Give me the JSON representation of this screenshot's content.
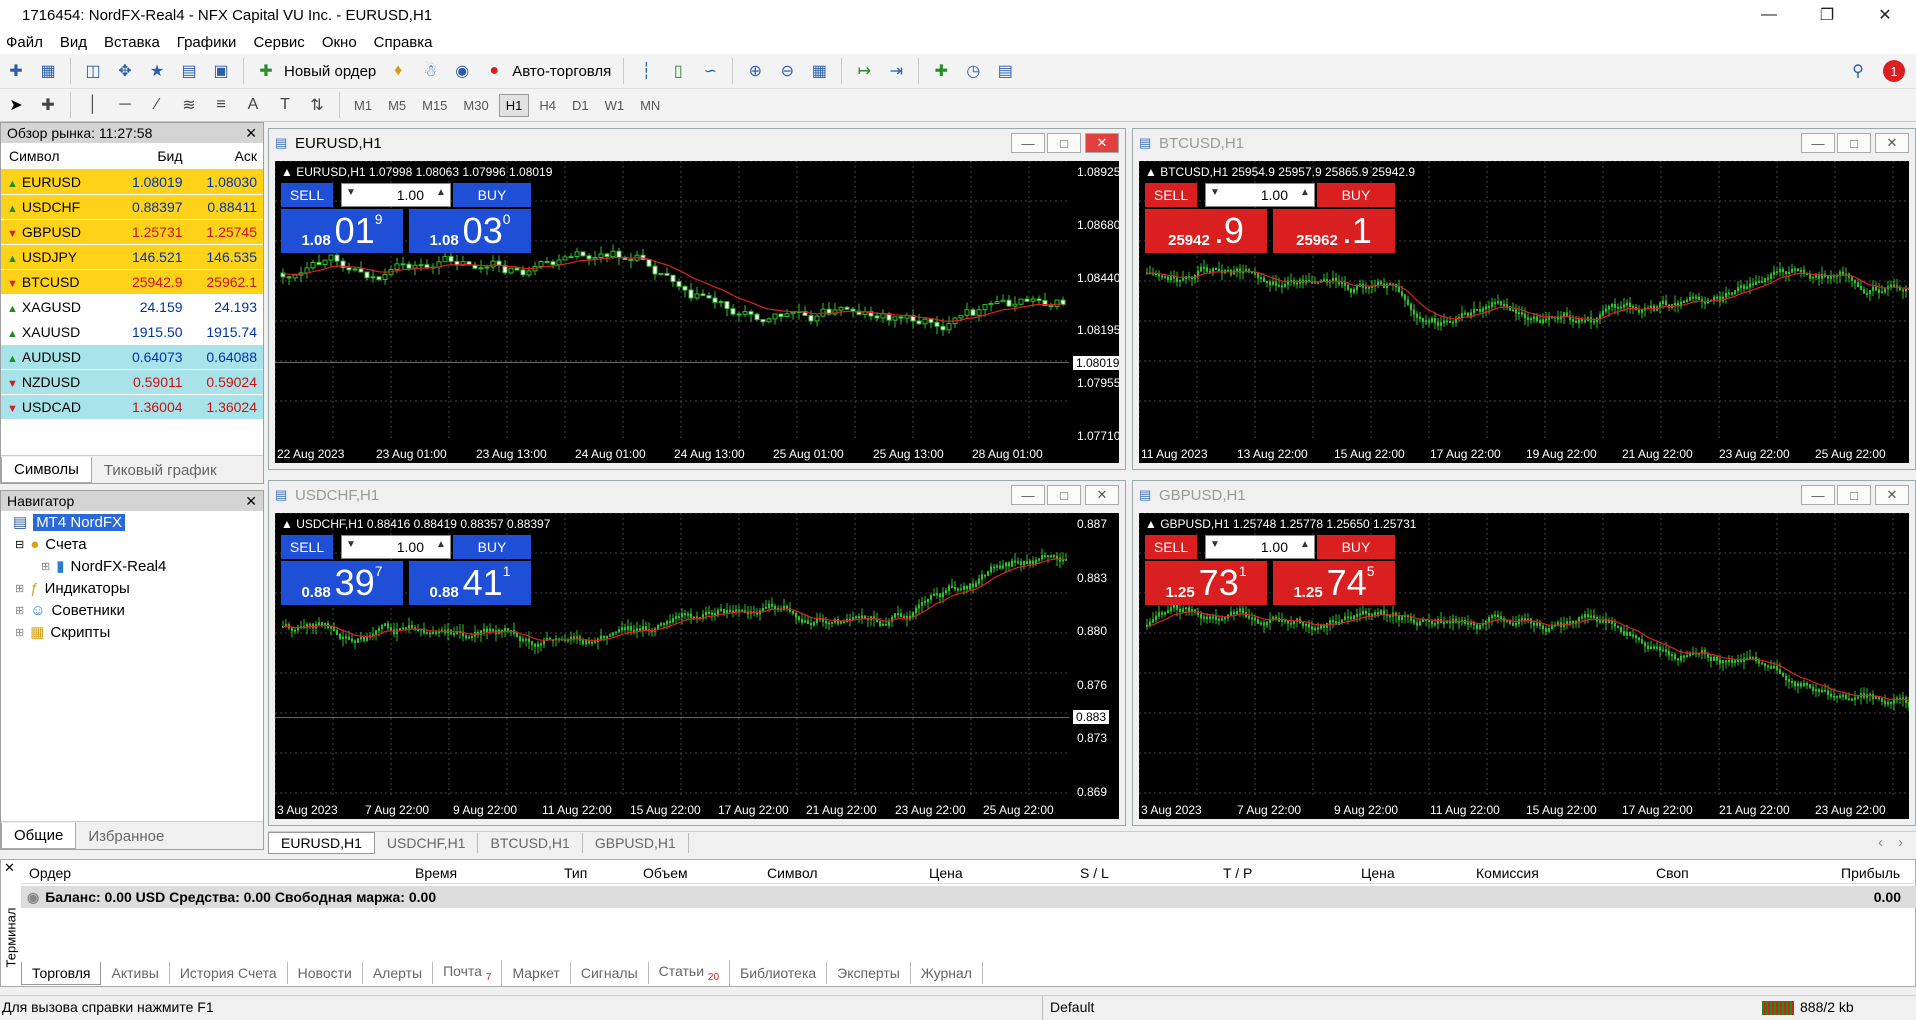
{
  "window": {
    "title": "1716454: NordFX-Real4 - NFX Capital VU Inc. - EURUSD,H1"
  },
  "menu": [
    "Файл",
    "Вид",
    "Вставка",
    "Графики",
    "Сервис",
    "Окно",
    "Справка"
  ],
  "toolbar": {
    "new_order": "Новый ордер",
    "autotrading": "Авто-торговля",
    "timeframes": [
      "M1",
      "M5",
      "M15",
      "M30",
      "H1",
      "H4",
      "D1",
      "W1",
      "MN"
    ],
    "active_tf": "H1",
    "notif_count": "1",
    "drawing_letter_a": "A",
    "drawing_letter_t": "T"
  },
  "market_watch": {
    "title": "Обзор рынка: 11:27:58",
    "headers": [
      "Символ",
      "Бид",
      "Аск"
    ],
    "rows": [
      {
        "sym": "EURUSD",
        "bid": "1.08019",
        "ask": "1.08030",
        "dir": "up",
        "bg": "#ffd21a"
      },
      {
        "sym": "USDCHF",
        "bid": "0.88397",
        "ask": "0.88411",
        "dir": "up",
        "bg": "#ffd21a"
      },
      {
        "sym": "GBPUSD",
        "bid": "1.25731",
        "ask": "1.25745",
        "dir": "dn",
        "bg": "#ffd21a"
      },
      {
        "sym": "USDJPY",
        "bid": "146.521",
        "ask": "146.535",
        "dir": "up",
        "bg": "#ffd21a"
      },
      {
        "sym": "BTCUSD",
        "bid": "25942.9",
        "ask": "25962.1",
        "dir": "dn",
        "bg": "#ffd21a"
      },
      {
        "sym": "XAGUSD",
        "bid": "24.159",
        "ask": "24.193",
        "dir": "up",
        "bg": "#ffffff"
      },
      {
        "sym": "XAUUSD",
        "bid": "1915.50",
        "ask": "1915.74",
        "dir": "up",
        "bg": "#ffffff"
      },
      {
        "sym": "AUDUSD",
        "bid": "0.64073",
        "ask": "0.64088",
        "dir": "up",
        "bg": "#a9e3ea"
      },
      {
        "sym": "NZDUSD",
        "bid": "0.59011",
        "ask": "0.59024",
        "dir": "dn",
        "bg": "#a9e3ea"
      },
      {
        "sym": "USDCAD",
        "bid": "1.36004",
        "ask": "1.36024",
        "dir": "dn",
        "bg": "#a9e3ea"
      }
    ],
    "tabs": [
      "Символы",
      "Тиковый график"
    ]
  },
  "navigator": {
    "title": "Навигатор",
    "root": "MT4 NordFX",
    "accounts": "Счета",
    "account": "NordFX-Real4",
    "indicators": "Индикаторы",
    "experts": "Советники",
    "scripts": "Скрипты",
    "tabs": [
      "Общие",
      "Избранное"
    ]
  },
  "charts": [
    {
      "title": "EURUSD,H1",
      "info": "EURUSD,H1  1.07998 1.08063 1.07996 1.08019",
      "lot": "1.00",
      "sell": "SELL",
      "buy": "BUY",
      "bid": {
        "small": "1.08",
        "big": "01",
        "pip": "9"
      },
      "ask": {
        "small": "1.08",
        "big": "03",
        "pip": "0"
      },
      "color": "blue",
      "prices": [
        "1.08925",
        "1.08680",
        "1.08440",
        "1.08195",
        "1.07955",
        "1.07710"
      ],
      "current": "1.08019",
      "dates": [
        "22 Aug 2023",
        "23 Aug 01:00",
        "23 Aug 13:00",
        "24 Aug 01:00",
        "24 Aug 13:00",
        "25 Aug 01:00",
        "25 Aug 13:00",
        "28 Aug 01:00"
      ]
    },
    {
      "title": "BTCUSD,H1",
      "info": "BTCUSD,H1  25954.9 25957.9 25865.9 25942.9",
      "lot": "1.00",
      "sell": "SELL",
      "buy": "BUY",
      "bid": {
        "small": "25942",
        "big": ".9",
        "pip": ""
      },
      "ask": {
        "small": "25962",
        "big": ".1",
        "pip": ""
      },
      "color": "red",
      "prices": [],
      "current": "",
      "dates": [
        "11 Aug 2023",
        "13 Aug 22:00",
        "15 Aug 22:00",
        "17 Aug 22:00",
        "19 Aug 22:00",
        "21 Aug 22:00",
        "23 Aug 22:00",
        "25 Aug 22:00"
      ]
    },
    {
      "title": "USDCHF,H1",
      "info": "USDCHF,H1  0.88416 0.88419 0.88357 0.88397",
      "lot": "1.00",
      "sell": "SELL",
      "buy": "BUY",
      "bid": {
        "small": "0.88",
        "big": "39",
        "pip": "7"
      },
      "ask": {
        "small": "0.88",
        "big": "41",
        "pip": "1"
      },
      "color": "blue",
      "prices": [
        "0.887",
        "0.883",
        "0.880",
        "0.876",
        "0.873",
        "0.869"
      ],
      "current": "0.883",
      "dates": [
        "3 Aug 2023",
        "7 Aug 22:00",
        "9 Aug 22:00",
        "11 Aug 22:00",
        "15 Aug 22:00",
        "17 Aug 22:00",
        "21 Aug 22:00",
        "23 Aug 22:00",
        "25 Aug 22:00"
      ]
    },
    {
      "title": "GBPUSD,H1",
      "info": "GBPUSD,H1  1.25748 1.25778 1.25650 1.25731",
      "lot": "1.00",
      "sell": "SELL",
      "buy": "BUY",
      "bid": {
        "small": "1.25",
        "big": "73",
        "pip": "1"
      },
      "ask": {
        "small": "1.25",
        "big": "74",
        "pip": "5"
      },
      "color": "red",
      "prices": [],
      "current": "",
      "dates": [
        "3 Aug 2023",
        "7 Aug 22:00",
        "9 Aug 22:00",
        "11 Aug 22:00",
        "15 Aug 22:00",
        "17 Aug 22:00",
        "21 Aug 22:00",
        "23 Aug 22:00"
      ]
    }
  ],
  "chart_tabs": [
    "EURUSD,H1",
    "USDCHF,H1",
    "BTCUSD,H1",
    "GBPUSD,H1"
  ],
  "terminal": {
    "side_label": "Терминал",
    "headers": [
      "Ордер",
      "Время",
      "Тип",
      "Объем",
      "Символ",
      "Цена",
      "S / L",
      "T / P",
      "Цена",
      "Комиссия",
      "Своп",
      "Прибыль"
    ],
    "balance": "Баланс: 0.00 USD  Средства: 0.00  Свободная маржа: 0.00",
    "profit": "0.00",
    "tabs": [
      "Торговля",
      "Активы",
      "История Счета",
      "Новости",
      "Алерты",
      "Почта",
      "Маркет",
      "Сигналы",
      "Статьи",
      "Библиотека",
      "Эксперты",
      "Журнал"
    ],
    "mail_count": "7",
    "articles_count": "20"
  },
  "status": {
    "help": "Для вызова справки нажмите F1",
    "profile": "Default",
    "traffic": "888/2 kb"
  }
}
